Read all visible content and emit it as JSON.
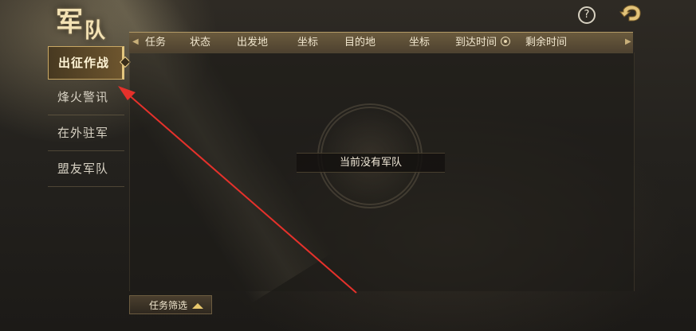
{
  "title": {
    "main": "军",
    "second": "队"
  },
  "sidebar": {
    "items": [
      {
        "label": "出征作战",
        "active": true
      },
      {
        "label": "烽火警讯",
        "active": false
      },
      {
        "label": "在外驻军",
        "active": false
      },
      {
        "label": "盟友军队",
        "active": false
      }
    ]
  },
  "topbar": {
    "help_label": "?",
    "help_icon": "question-circle-icon",
    "back_icon": "back-arrow-icon"
  },
  "table": {
    "columns": [
      "任务",
      "状态",
      "出发地",
      "坐标",
      "目的地",
      "坐标",
      "到达时间",
      "剩余时间"
    ],
    "sorted_column_icon": "sort-radio-icon",
    "empty_message": "当前没有军队"
  },
  "filter": {
    "label": "任务筛选"
  },
  "colors": {
    "accent_gold": "#c9a864",
    "annotation_arrow": "#e5312b",
    "text_light": "#f1e7cf"
  }
}
